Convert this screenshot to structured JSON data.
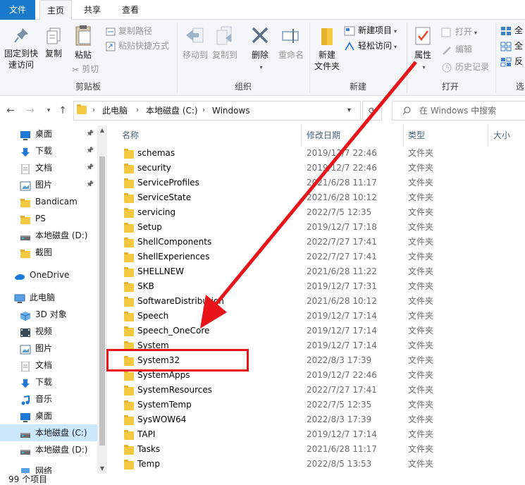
{
  "tabs": {
    "file": "文件",
    "home": "主页",
    "share": "共享",
    "view": "查看"
  },
  "ribbon": {
    "clipboard": {
      "pin": "固定到快速访问",
      "pin_line1": "固定到快",
      "pin_line2": "速访问",
      "copy": "复制",
      "paste": "粘贴",
      "copy_path": "复制路径",
      "paste_shortcut": "粘贴快捷方式",
      "cut": "剪切",
      "label": "剪贴板"
    },
    "organize": {
      "move_to": "移动到",
      "copy_to": "复制到",
      "delete": "删除",
      "rename": "重命名",
      "label": "组织"
    },
    "new": {
      "new_folder_line1": "新建",
      "new_folder_line2": "文件夹",
      "new_item": "新建项目",
      "easy_access": "轻松访问",
      "label": "新建"
    },
    "open": {
      "properties": "属性",
      "open": "打开",
      "edit": "编辑",
      "history": "历史记录",
      "label": "打开"
    },
    "select": {
      "all1": "全",
      "all2": "全",
      "invert": "反",
      "label": "选"
    }
  },
  "address": {
    "crumbs": [
      "此电脑",
      "本地磁盘 (C:)",
      "Windows"
    ],
    "search_placeholder": "在 Windows 中搜索"
  },
  "nav": {
    "items": [
      {
        "label": "桌面",
        "icon": "desktop-icon",
        "pinned": true
      },
      {
        "label": "下载",
        "icon": "download-icon",
        "pinned": true
      },
      {
        "label": "文档",
        "icon": "document-icon",
        "pinned": true
      },
      {
        "label": "图片",
        "icon": "picture-icon",
        "pinned": true
      },
      {
        "label": "Bandicam",
        "icon": "folder-icon",
        "pinned": false
      },
      {
        "label": "PS",
        "icon": "folder-icon",
        "pinned": false
      },
      {
        "label": "本地磁盘 (D:)",
        "icon": "drive-icon",
        "pinned": false
      },
      {
        "label": "截图",
        "icon": "folder-icon",
        "pinned": false
      },
      {
        "label": "OneDrive",
        "icon": "cloud-icon",
        "pinned": false
      },
      {
        "label": "此电脑",
        "icon": "computer-icon",
        "pinned": false
      },
      {
        "label": "3D 对象",
        "icon": "cube-icon",
        "pinned": false
      },
      {
        "label": "视频",
        "icon": "video-icon",
        "pinned": false
      },
      {
        "label": "图片",
        "icon": "picture-icon",
        "pinned": false
      },
      {
        "label": "文档",
        "icon": "document-icon",
        "pinned": false
      },
      {
        "label": "下载",
        "icon": "download-icon",
        "pinned": false
      },
      {
        "label": "音乐",
        "icon": "music-icon",
        "pinned": false
      },
      {
        "label": "桌面",
        "icon": "desktop-icon",
        "pinned": false
      },
      {
        "label": "本地磁盘 (C:)",
        "icon": "drive-icon",
        "pinned": false,
        "selected": true
      },
      {
        "label": "本地磁盘 (D:)",
        "icon": "drive-icon",
        "pinned": false
      },
      {
        "label": "网络",
        "icon": "network-icon",
        "pinned": false
      }
    ]
  },
  "columns": {
    "name": "名称",
    "date": "修改日期",
    "type": "类型",
    "size": "大小"
  },
  "files": [
    {
      "name": "schemas",
      "date": "2019/12/7 22:46",
      "type": "文件夹"
    },
    {
      "name": "security",
      "date": "2019/12/7 22:46",
      "type": "文件夹"
    },
    {
      "name": "ServiceProfiles",
      "date": "2021/6/28 11:17",
      "type": "文件夹"
    },
    {
      "name": "ServiceState",
      "date": "2021/6/28 10:12",
      "type": "文件夹"
    },
    {
      "name": "servicing",
      "date": "2022/7/5 12:35",
      "type": "文件夹"
    },
    {
      "name": "Setup",
      "date": "2019/12/7 17:18",
      "type": "文件夹"
    },
    {
      "name": "ShellComponents",
      "date": "2022/7/27 17:41",
      "type": "文件夹"
    },
    {
      "name": "ShellExperiences",
      "date": "2022/7/27 17:41",
      "type": "文件夹"
    },
    {
      "name": "SHELLNEW",
      "date": "2021/6/28 11:22",
      "type": "文件夹"
    },
    {
      "name": "SKB",
      "date": "2019/12/7 17:31",
      "type": "文件夹"
    },
    {
      "name": "SoftwareDistribution",
      "date": "2021/6/28 10:12",
      "type": "文件夹"
    },
    {
      "name": "Speech",
      "date": "2019/12/7 17:14",
      "type": "文件夹"
    },
    {
      "name": "Speech_OneCore",
      "date": "2019/12/7 17:14",
      "type": "文件夹"
    },
    {
      "name": "System",
      "date": "2019/12/7 17:14",
      "type": "文件夹"
    },
    {
      "name": "System32",
      "date": "2022/8/3 17:39",
      "type": "文件夹"
    },
    {
      "name": "SystemApps",
      "date": "2019/12/7 22:46",
      "type": "文件夹"
    },
    {
      "name": "SystemResources",
      "date": "2022/7/27 17:41",
      "type": "文件夹"
    },
    {
      "name": "SystemTemp",
      "date": "2022/7/5 12:35",
      "type": "文件夹"
    },
    {
      "name": "SysWOW64",
      "date": "2022/8/3 17:39",
      "type": "文件夹"
    },
    {
      "name": "TAPI",
      "date": "2019/12/7 17:14",
      "type": "文件夹"
    },
    {
      "name": "Tasks",
      "date": "2021/6/28 11:17",
      "type": "文件夹"
    },
    {
      "name": "Temp",
      "date": "2022/8/5 13:53",
      "type": "文件夹"
    }
  ],
  "status": {
    "count": "99 个项目"
  },
  "colors": {
    "accent": "#1979ca",
    "selection": "#cce8ff",
    "annotation": "#e8141a",
    "folder": "#f4c840"
  }
}
